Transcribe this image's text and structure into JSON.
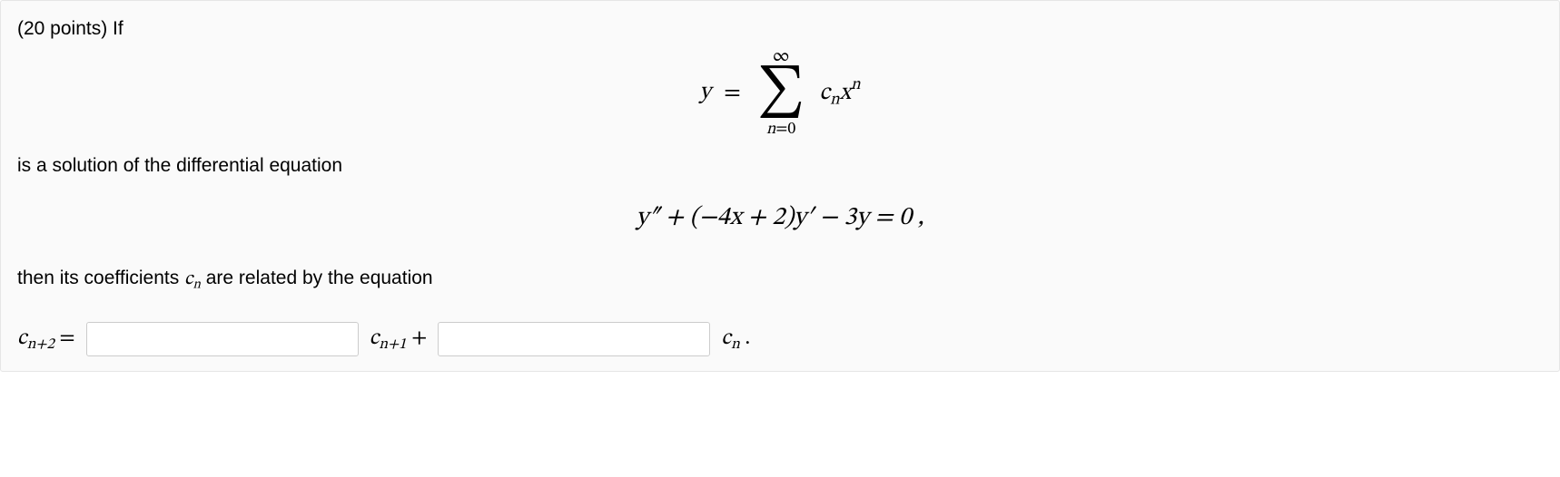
{
  "points_prefix": "(20 points) If",
  "series_formula": {
    "lhs": "y",
    "equals": "=",
    "sum_upper": "∞",
    "sum_symbol": "∑",
    "sum_lower_var": "n",
    "sum_lower_eq": "=0",
    "term_c": "c",
    "term_c_sub": "n",
    "term_x": "x",
    "term_x_exp": "n"
  },
  "middle_text": "is a solution of the differential equation",
  "ode": "y″ + (−4x + 2)y′ − 3y = 0 ,",
  "bottom_text_pre": "then its coefficients ",
  "bottom_text_c": "c",
  "bottom_text_c_sub": "n",
  "bottom_text_post": " are related by the equation",
  "answer_row": {
    "c_np2_c": "c",
    "c_np2_sub": "n+2",
    "equals": " =",
    "input1_value": "",
    "c_np1_c": "c",
    "c_np1_sub": "n+1",
    "plus": " +",
    "input2_value": "",
    "c_n_c": "c",
    "c_n_sub": "n",
    "period": " ."
  }
}
